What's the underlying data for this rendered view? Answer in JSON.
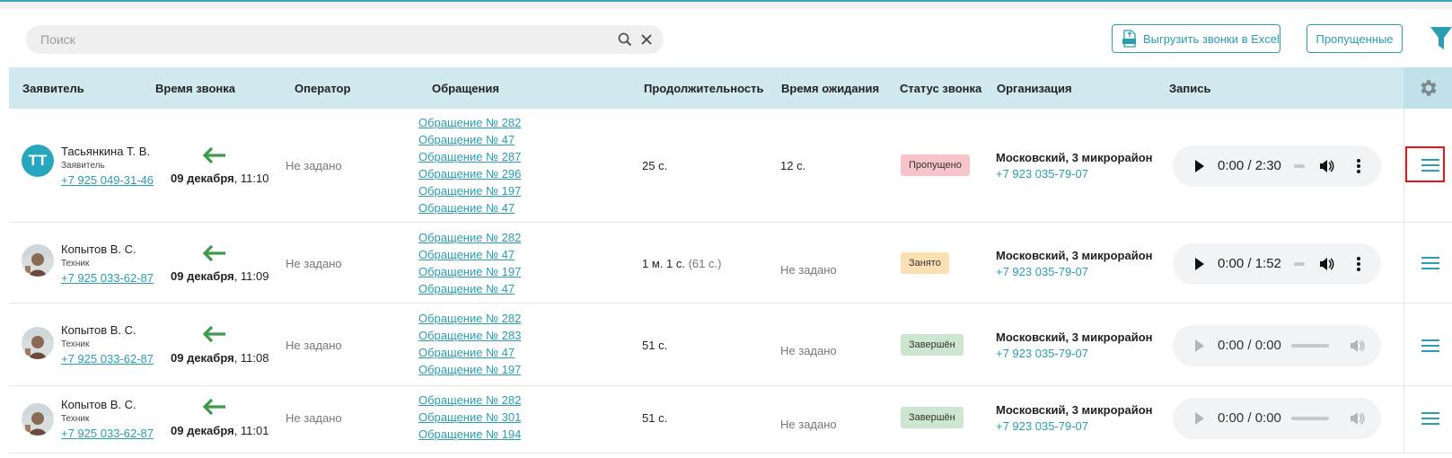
{
  "search": {
    "placeholder": "Поиск"
  },
  "toolbar": {
    "export_label": "Выгрузить звонки в Excel",
    "missed_label": "Пропущенные"
  },
  "columns": [
    "Заявитель",
    "Время звонка",
    "Оператор",
    "Обращения",
    "Продолжительность",
    "Время ожидания",
    "Статус звонка",
    "Организация",
    "Запись"
  ],
  "colors": {
    "accent": "#2a9db2",
    "header_bg": "#cfe9ee",
    "arrow": "#3c9a4a",
    "highlight": "#e11111"
  },
  "rows": [
    {
      "name": "Тасьянкина Т. В.",
      "role": "Заявитель",
      "phone": "+7 925 049-31-46",
      "avatar": "ТТ",
      "date": "09 декабря",
      "time": ", 11:10",
      "operator": "Не задано",
      "requests": [
        "Обращение № 282",
        "Обращение № 47",
        "Обращение № 287",
        "Обращение № 296",
        "Обращение № 197",
        "Обращение № 47"
      ],
      "duration": "25 с.",
      "duration_extra": "",
      "wait": "12 с.",
      "status": "Пропущено",
      "org": "Московский, 3 микрорайон",
      "org_phone": "+7 923 035-79-07",
      "audio": "0:00 / 2:30"
    },
    {
      "name": "Копытов В. С.",
      "role": "Техник",
      "phone": "+7 925 033-62-87",
      "avatar": "",
      "date": "09 декабря",
      "time": ", 11:09",
      "operator": "Не задано",
      "requests": [
        "Обращение № 282",
        "Обращение № 47",
        "Обращение № 197",
        "Обращение № 47"
      ],
      "duration": "1 м. 1 с.",
      "duration_extra": " (61 с.)",
      "wait": "Не задано",
      "status": "Занято",
      "org": "Московский, 3 микрорайон",
      "org_phone": "+7 923 035-79-07",
      "audio": "0:00 / 1:52"
    },
    {
      "name": "Копытов В. С.",
      "role": "Техник",
      "phone": "+7 925 033-62-87",
      "avatar": "",
      "date": "09 декабря",
      "time": ", 11:08",
      "operator": "Не задано",
      "requests": [
        "Обращение № 282",
        "Обращение № 283",
        "Обращение № 47",
        "Обращение № 197"
      ],
      "duration": "51 с.",
      "duration_extra": "",
      "wait": "Не задано",
      "status": "Завершён",
      "org": "Московский, 3 микрорайон",
      "org_phone": "+7 923 035-79-07",
      "audio": "0:00 / 0:00"
    },
    {
      "name": "Копытов В. С.",
      "role": "Техник",
      "phone": "+7 925 033-62-87",
      "avatar": "",
      "date": "09 декабря",
      "time": ", 11:01",
      "operator": "Не задано",
      "requests": [
        "Обращение № 282",
        "Обращение № 301",
        "Обращение № 194"
      ],
      "duration": "51 с.",
      "duration_extra": "",
      "wait": "Не задано",
      "status": "Завершён",
      "org": "Московский, 3 микрорайон",
      "org_phone": "+7 923 035-79-07",
      "audio": "0:00 / 0:00"
    }
  ]
}
